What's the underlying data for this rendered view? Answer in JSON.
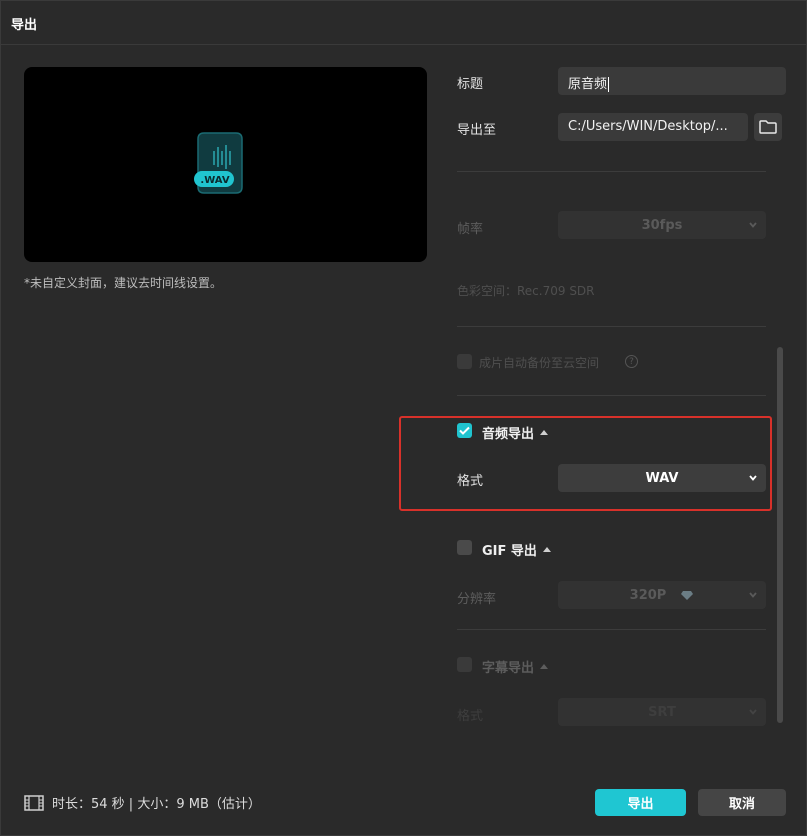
{
  "window": {
    "title": "导出"
  },
  "preview": {
    "file_badge": ".WAV",
    "cover_note": "*未自定义封面，建议去时间线设置。"
  },
  "form": {
    "title_label": "标题",
    "title_value": "原音频",
    "export_to_label": "导出至",
    "export_to_value": "C:/Users/WIN/Desktop/...",
    "frame_rate_label": "帧率",
    "frame_rate_value": "30fps",
    "color_space_text": "色彩空间：Rec.709 SDR",
    "auto_backup_label": "成片自动备份至云空间",
    "help_glyph": "?"
  },
  "audio_export": {
    "checked": true,
    "label": "音频导出",
    "format_label": "格式",
    "format_value": "WAV"
  },
  "gif_export": {
    "checked": false,
    "label": "GIF 导出",
    "resolution_label": "分辨率",
    "resolution_value": "320P"
  },
  "subtitle_export": {
    "checked": false,
    "label": "字幕导出",
    "format_label": "格式",
    "format_value": "SRT"
  },
  "footer": {
    "summary": "时长：54 秒 | 大小：9 MB（估计）",
    "export_button": "导出",
    "cancel_button": "取消"
  },
  "colors": {
    "accent": "#1fc6d2",
    "highlight_border": "#d8312a",
    "background": "#2a2a2a"
  },
  "icons": [
    "wav-file-icon",
    "folder-icon",
    "chevron-down-icon",
    "check-icon",
    "help-icon",
    "diamond-icon",
    "film-icon"
  ]
}
